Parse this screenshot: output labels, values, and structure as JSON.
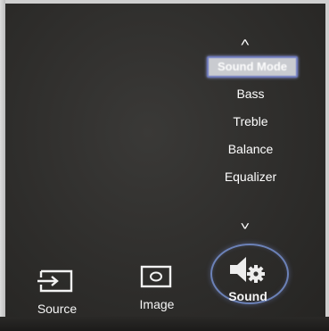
{
  "menu": {
    "up_arrow": "˄",
    "down_arrow": "˅",
    "items": [
      {
        "label": "Sound Mode",
        "selected": true
      },
      {
        "label": "Bass",
        "selected": false
      },
      {
        "label": "Treble",
        "selected": false
      },
      {
        "label": "Balance",
        "selected": false
      },
      {
        "label": "Equalizer",
        "selected": false
      }
    ]
  },
  "bottom_bar": {
    "items": [
      {
        "label": "Source",
        "icon": "source-input-icon",
        "selected": false
      },
      {
        "label": "Image",
        "icon": "image-picture-icon",
        "selected": false
      },
      {
        "label": "Sound",
        "icon": "speaker-gear-icon",
        "selected": true
      }
    ]
  },
  "colors": {
    "background": "#2e2d2b",
    "text": "#ffffff",
    "highlight": "#c9cbd0",
    "highlight_border": "#6f7cc2",
    "ring": "#6c82b8"
  }
}
